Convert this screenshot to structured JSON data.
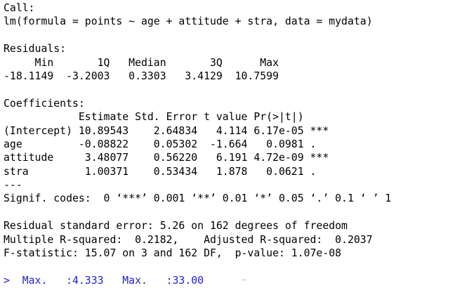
{
  "colors": {
    "output_text": "#000000",
    "prompt_text": "#1f1fd6",
    "background": "#ffffff"
  },
  "console": {
    "call_header": "Call:",
    "call": "lm(formula = points ~ age + attitude + stra, data = mydata)",
    "blank1": "",
    "residuals_header": "Residuals:",
    "residuals_labels": "     Min       1Q   Median       3Q      Max ",
    "residuals_values": "-18.1149  -3.2003   0.3303   3.4129  10.7599 ",
    "blank2": "",
    "coef_header": "Coefficients:",
    "coef_columns": "            Estimate Std. Error t value Pr(>|t|)    ",
    "coef_rows": [
      "(Intercept) 10.89543    2.64834   4.114 6.17e-05 ***",
      "age         -0.08822    0.05302  -1.664   0.0981 .  ",
      "attitude     3.48077    0.56220   6.191 4.72e-09 ***",
      "stra         1.00371    0.53434   1.878   0.0621 .  "
    ],
    "separator": "---",
    "signif_codes": "Signif. codes:  0 ‘***’ 0.001 ‘**’ 0.01 ‘*’ 0.05 ‘.’ 0.1 ‘ ’ 1",
    "blank3": "",
    "residual_se": "Residual standard error: 5.26 on 162 degrees of freedom",
    "r_squared": "Multiple R-squared:  0.2182,\tAdjusted R-squared:  0.2037 ",
    "f_statistic": "F-statistic: 15.07 on 3 and 162 DF,  p-value: 1.07e-08",
    "blank4": "",
    "prompt_line": ">  Max.   :4.333   Max.   :33.00  "
  }
}
